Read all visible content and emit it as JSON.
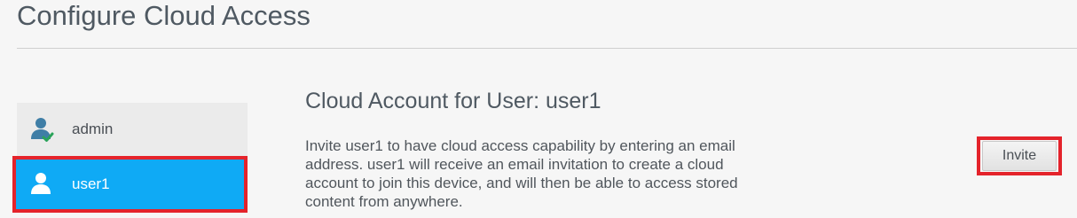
{
  "page": {
    "title": "Configure Cloud Access"
  },
  "users": [
    {
      "label": "admin",
      "icon": "user-check-icon",
      "selected": false
    },
    {
      "label": "user1",
      "icon": "user-icon",
      "selected": true
    }
  ],
  "main": {
    "title": "Cloud Account for User: user1",
    "description": "Invite user1 to have cloud access capability by entering an email address. user1 will receive an email invitation to create a cloud account to join this device, and will then be able to access stored content from anywhere.",
    "invite_label": "Invite"
  },
  "colors": {
    "accent": "#0faaf5",
    "highlight_border": "#e4232b",
    "check": "#2aa35a",
    "admin_icon": "#3f7ea6"
  }
}
